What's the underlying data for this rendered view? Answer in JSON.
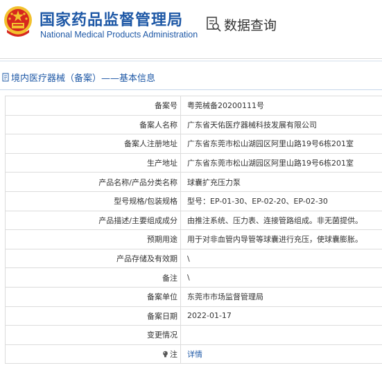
{
  "header": {
    "cn_title": "国家药品监督管理局",
    "en_title": "National Medical Products Administration",
    "query_label": "数据查询"
  },
  "section": {
    "title": "境内医疗器械（备案）——基本信息"
  },
  "rows": [
    {
      "label": "备案号",
      "value": "粤莞械备20200111号"
    },
    {
      "label": "备案人名称",
      "value": "广东省天佑医疗器械科技发展有限公司"
    },
    {
      "label": "备案人注册地址",
      "value": "广东省东莞市松山湖园区阿里山路19号6栋201室"
    },
    {
      "label": "生产地址",
      "value": "广东省东莞市松山湖园区阿里山路19号6栋201室"
    },
    {
      "label": "产品名称/产品分类名称",
      "value": "球囊扩充压力泵"
    },
    {
      "label": "型号规格/包装规格",
      "value": "型号：EP-01-30、EP-02-20、EP-02-30"
    },
    {
      "label": "产品描述/主要组成成分",
      "value": "由推注系统、压力表、连接管路组成。非无菌提供。"
    },
    {
      "label": "预期用途",
      "value": "用于对非血管内导管等球囊进行充压，使球囊膨胀。"
    },
    {
      "label": "产品存储及有效期",
      "value": "\\"
    },
    {
      "label": "备注",
      "value": "\\"
    },
    {
      "label": "备案单位",
      "value": "东莞市市场监督管理局"
    },
    {
      "label": "备案日期",
      "value": "2022-01-17"
    },
    {
      "label": "变更情况",
      "value": ""
    },
    {
      "label": "注",
      "value": "详情"
    }
  ],
  "icons": {
    "emblem": "national-emblem-icon",
    "query": "data-query-icon",
    "section": "document-icon",
    "note": "lightbulb-icon"
  },
  "colors": {
    "brand_blue": "#1e58a6",
    "emblem_red": "#d7281e",
    "emblem_gold": "#f2c12e"
  }
}
